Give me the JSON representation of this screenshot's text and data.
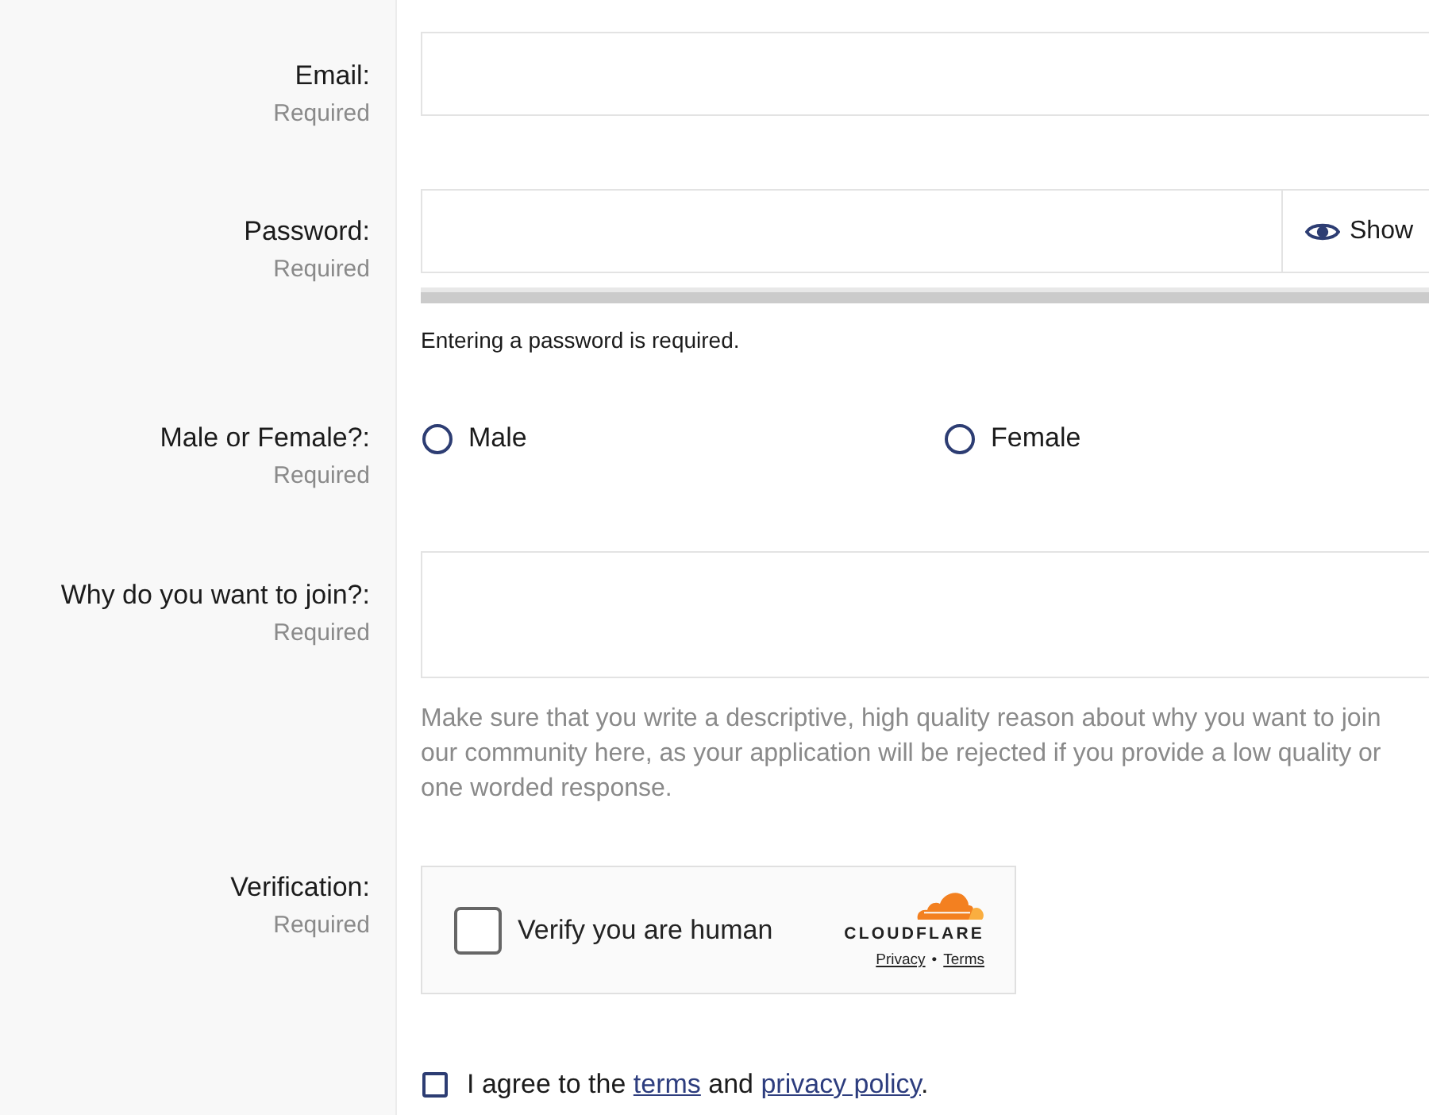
{
  "fields": [
    {
      "kind": "text_input",
      "label": "Email:",
      "required": "Required"
    },
    {
      "kind": "password",
      "label": "Password:",
      "required": "Required",
      "toggle": "Show",
      "message": "Entering a password is required."
    },
    {
      "kind": "radio",
      "label": "Male or Female?:",
      "required": "Required",
      "options": [
        {
          "label": "Male",
          "selected": false
        },
        {
          "label": "Female",
          "selected": false
        }
      ]
    },
    {
      "kind": "textarea",
      "label": "Why do you want to join?:",
      "required": "Required",
      "help": "Make sure that you write a descriptive, high quality reason about why you want to join our community here, as your application will be rejected if you provide a low quality or one worded response."
    },
    {
      "kind": "captcha",
      "label": "Verification:",
      "required": "Required",
      "captcha": {
        "checked": false,
        "text": "Verify you are human",
        "logo_text": "CLOUDFLARE",
        "links": [
          "Privacy",
          "Terms"
        ],
        "separator": "•"
      }
    }
  ],
  "agreement": {
    "checked": false,
    "parts": [
      {
        "kind": "text",
        "text": "I agree to the "
      },
      {
        "kind": "link",
        "text": "terms"
      },
      {
        "kind": "text",
        "text": " and "
      },
      {
        "kind": "link",
        "text": "privacy policy"
      },
      {
        "kind": "text",
        "text": "."
      }
    ]
  }
}
